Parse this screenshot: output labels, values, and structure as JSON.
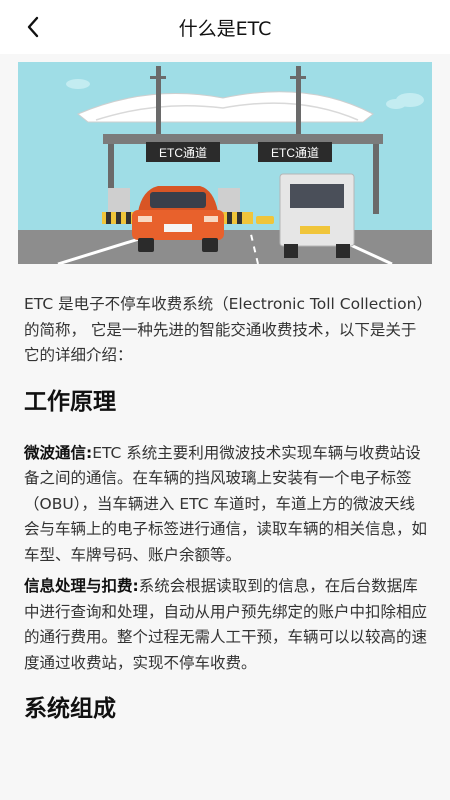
{
  "header": {
    "title": "什么是ETC",
    "back_icon": "chevron-left-icon"
  },
  "hero": {
    "gate_left_label": "ETC通道",
    "gate_right_label": "ETC通道",
    "colors": {
      "sky": "#9fdde6",
      "road": "#8d8d8d",
      "car": "#e8612c",
      "truck": "#e6e6e6"
    }
  },
  "intro": "ETC 是电子不停车收费系统（Electronic Toll Collection）的简称， 它是一种先进的智能交通收费技术，以下是关于它的详细介绍：",
  "sections": [
    {
      "heading": "工作原理",
      "items": [
        {
          "lead": "微波通信:",
          "text": "ETC 系统主要利用微波技术实现车辆与收费站设备之间的通信。在车辆的挡风玻璃上安装有一个电子标签（OBU），当车辆进入 ETC 车道时，车道上方的微波天线会与车辆上的电子标签进行通信，读取车辆的相关信息，如车型、车牌号码、账户余额等。"
        },
        {
          "lead": "信息处理与扣费:",
          "text": "系统会根据读取到的信息，在后台数据库中进行查询和处理，自动从用户预先绑定的账户中扣除相应的通行费用。整个过程无需人工干预，车辆可以以较高的速度通过收费站，实现不停车收费。"
        }
      ]
    },
    {
      "heading": "系统组成",
      "items": []
    }
  ]
}
